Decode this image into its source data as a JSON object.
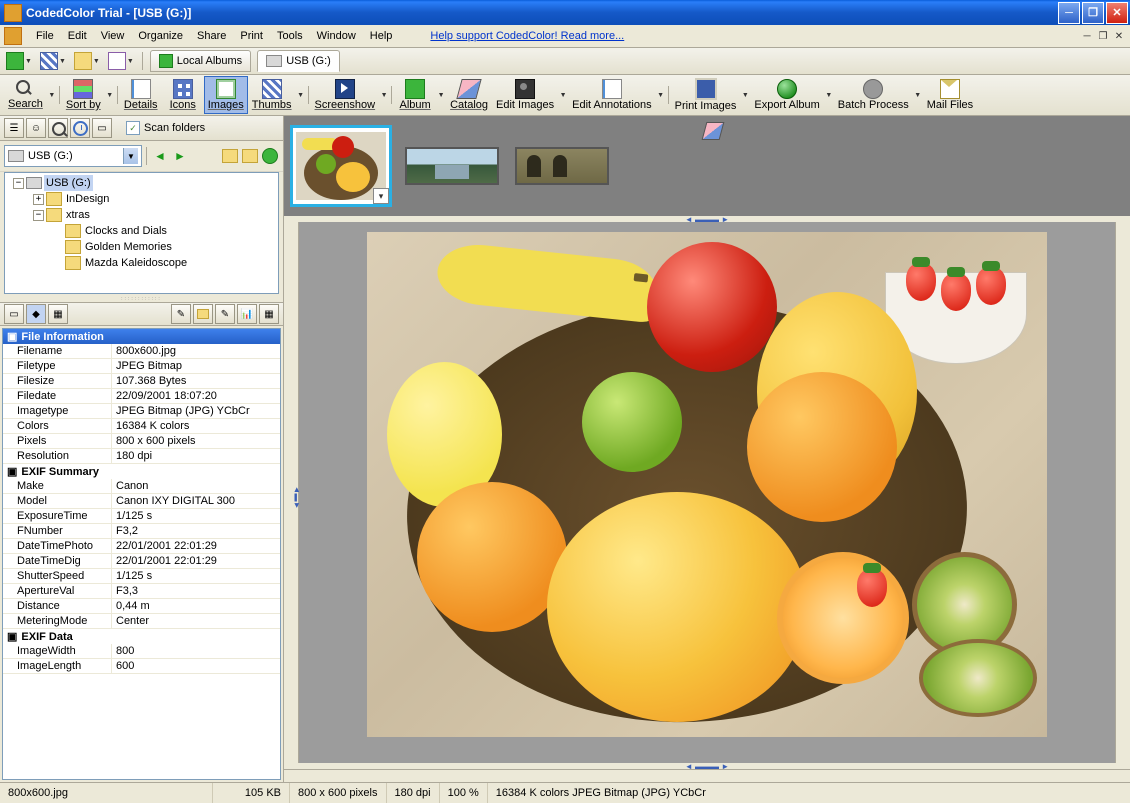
{
  "title": "CodedColor Trial - [USB (G:)]",
  "menu": {
    "file": "File",
    "edit": "Edit",
    "view": "View",
    "organize": "Organize",
    "share": "Share",
    "print": "Print",
    "tools": "Tools",
    "window": "Window",
    "help": "Help"
  },
  "help_link": "Help support CodedColor! Read more...",
  "tabs": {
    "local": "Local Albums",
    "usb": "USB (G:)"
  },
  "toolbar": {
    "search": "Search",
    "sortby": "Sort by",
    "details": "Details",
    "icons": "Icons",
    "images": "Images",
    "thumbs": "Thumbs",
    "screenshow": "Screenshow",
    "album": "Album",
    "catalog": "Catalog",
    "editimages": "Edit Images",
    "editanno": "Edit Annotations",
    "printimgs": "Print Images",
    "exportalbum": "Export Album",
    "batch": "Batch Process",
    "mail": "Mail Files"
  },
  "scan_folders": "Scan folders",
  "combo_drive": "USB (G:)",
  "tree": {
    "root": "USB (G:)",
    "n1": "InDesign",
    "n2": "xtras",
    "n2a": "Clocks and Dials",
    "n2b": "Golden Memories",
    "n2c": "Mazda Kaleidoscope"
  },
  "fileinfo": {
    "header": "File Information",
    "r": [
      {
        "k": "Filename",
        "v": "800x600.jpg"
      },
      {
        "k": "Filetype",
        "v": "JPEG Bitmap"
      },
      {
        "k": "Filesize",
        "v": "107.368 Bytes"
      },
      {
        "k": "Filedate",
        "v": "22/09/2001 18:07:20"
      },
      {
        "k": "Imagetype",
        "v": "JPEG Bitmap (JPG) YCbCr"
      },
      {
        "k": "Colors",
        "v": "16384 K colors"
      },
      {
        "k": "Pixels",
        "v": "800 x 600 pixels"
      },
      {
        "k": "Resolution",
        "v": "180 dpi"
      }
    ]
  },
  "exifsum": {
    "header": "EXIF Summary",
    "r": [
      {
        "k": "Make",
        "v": "Canon"
      },
      {
        "k": "Model",
        "v": "Canon IXY DIGITAL 300"
      },
      {
        "k": "ExposureTime",
        "v": "1/125 s"
      },
      {
        "k": "FNumber",
        "v": "F3,2"
      },
      {
        "k": "DateTimePhoto",
        "v": "22/01/2001 22:01:29"
      },
      {
        "k": "DateTimeDig",
        "v": "22/01/2001 22:01:29"
      },
      {
        "k": "ShutterSpeed",
        "v": "1/125 s"
      },
      {
        "k": "ApertureVal",
        "v": "F3,3"
      },
      {
        "k": "Distance",
        "v": "0,44 m"
      },
      {
        "k": "MeteringMode",
        "v": "Center"
      }
    ]
  },
  "exifdata": {
    "header": "EXIF Data",
    "r": [
      {
        "k": "ImageWidth",
        "v": "800"
      },
      {
        "k": "ImageLength",
        "v": "600"
      }
    ]
  },
  "status": {
    "file": "800x600.jpg",
    "size": "105 KB",
    "pixels": "800 x 600 pixels",
    "dpi": "180 dpi",
    "zoom": "100 %",
    "info": "16384 K colors JPEG Bitmap (JPG) YCbCr"
  }
}
